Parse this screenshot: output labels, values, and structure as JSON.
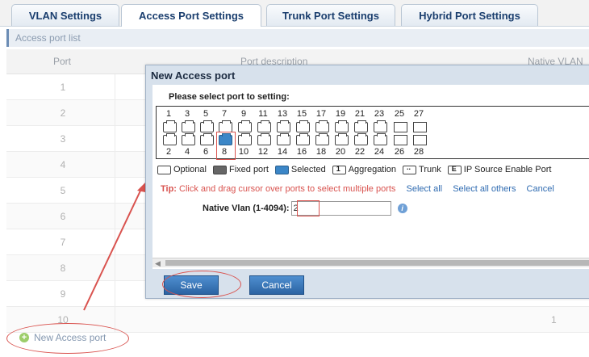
{
  "tabs": [
    "VLAN Settings",
    "Access Port Settings",
    "Trunk Port Settings",
    "Hybrid Port Settings"
  ],
  "list_title": "Access port list",
  "table": {
    "headers": [
      "Port",
      "Port description",
      "Native VLAN"
    ],
    "rows": [
      {
        "port": "1",
        "native_vlan": ""
      },
      {
        "port": "2",
        "native_vlan": ""
      },
      {
        "port": "3",
        "native_vlan": ""
      },
      {
        "port": "4",
        "native_vlan": ""
      },
      {
        "port": "5",
        "native_vlan": ""
      },
      {
        "port": "6",
        "native_vlan": ""
      },
      {
        "port": "7",
        "native_vlan": ""
      },
      {
        "port": "8",
        "native_vlan": ""
      },
      {
        "port": "9",
        "native_vlan": ""
      },
      {
        "port": "10",
        "native_vlan": "1"
      }
    ]
  },
  "new_access_port_label": "New Access port",
  "dialog": {
    "title": "New Access port",
    "prompt": "Please select port to setting:",
    "top_port_numbers": [
      "1",
      "3",
      "5",
      "7",
      "9",
      "11",
      "13",
      "15",
      "17",
      "19",
      "21",
      "23",
      "25",
      "27"
    ],
    "bottom_port_numbers": [
      "2",
      "4",
      "6",
      "8",
      "10",
      "12",
      "14",
      "16",
      "18",
      "20",
      "22",
      "24",
      "26",
      "28"
    ],
    "selected_port": "8",
    "legend": {
      "optional": "Optional",
      "fixed": "Fixed port",
      "selected": "Selected",
      "aggregation": "Aggregation",
      "trunk": "Trunk",
      "ip_source": "IP Source Enable Port",
      "aggregation_glyph": "1",
      "trunk_glyph": "..",
      "ip_source_glyph": "E"
    },
    "tip_label": "Tip:",
    "tip_text": "Click and drag cursor over ports to select multiple ports",
    "select_all": "Select all",
    "select_all_others": "Select all others",
    "cancel_link": "Cancel",
    "native_vlan_label": "Native Vlan (1-4094):",
    "native_vlan_value": "2",
    "info_glyph": "i",
    "save_label": "Save",
    "cancel_label": "Cancel"
  },
  "colors": {
    "accent": "#3b86c7",
    "annotation_red": "#d9534f",
    "tip_red": "#d9534f",
    "link_blue": "#2f6bb1"
  }
}
